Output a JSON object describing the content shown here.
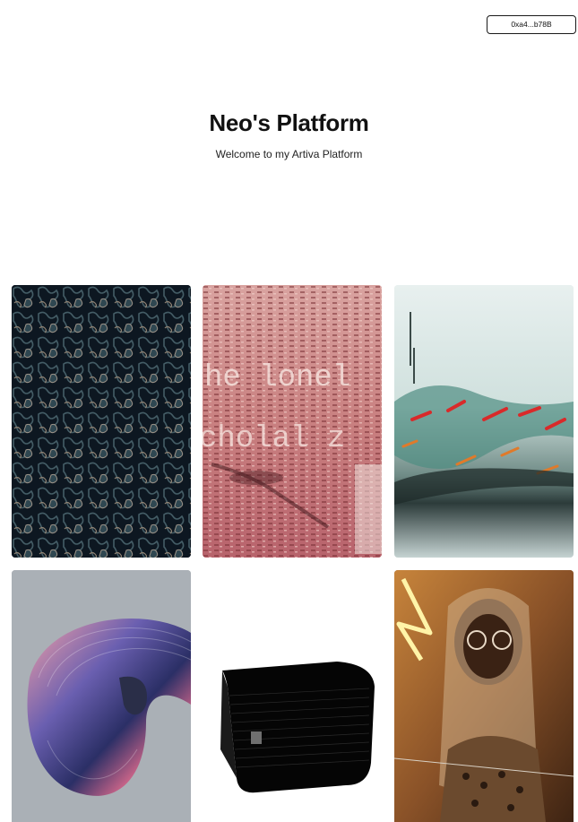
{
  "header": {
    "wallet_address": "0xa4...b78B"
  },
  "hero": {
    "title": "Neo's Platform",
    "subtitle": "Welcome to my Artiva Platform"
  },
  "gallery": {
    "items": [
      {
        "art_text": ""
      },
      {
        "art_text": "he lonel"
      },
      {
        "art_text": ""
      },
      {
        "art_text": ""
      },
      {
        "art_text": ""
      },
      {
        "art_text": ""
      }
    ],
    "artwork_2_line2": "cholal z"
  }
}
